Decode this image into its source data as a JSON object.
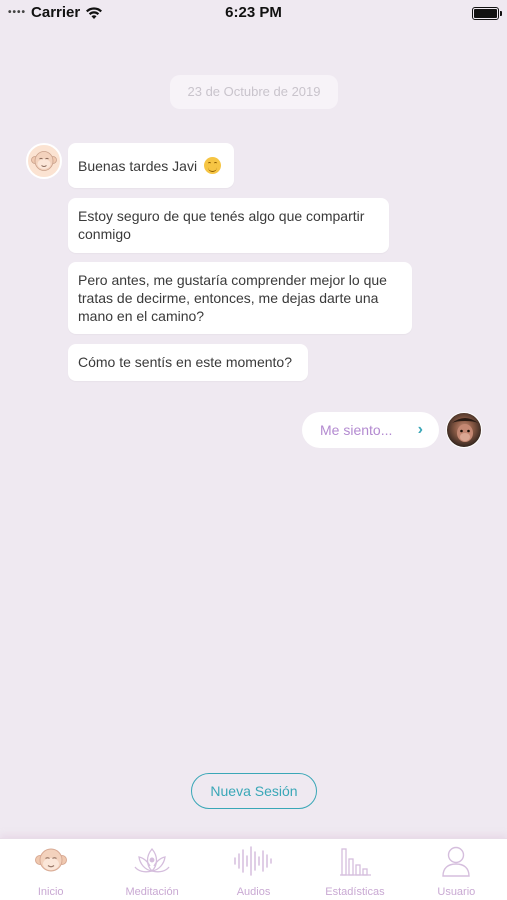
{
  "status_bar": {
    "signal": "••••",
    "carrier": "Carrier",
    "time": "6:23 PM"
  },
  "chat": {
    "date": "23 de Octubre de 2019",
    "bot_messages": [
      "Buenas tardes Javi",
      "Estoy seguro de que tenés algo que compartir conmigo",
      "Pero antes, me gustaría comprender mejor lo que tratas de decirme, entonces, me dejas darte una mano en el camino?",
      "Cómo te sentís en este momento?"
    ],
    "reply_option": "Me siento...",
    "reply_chevron": "›"
  },
  "actions": {
    "new_session": "Nueva Sesión"
  },
  "tab_bar": {
    "items": [
      {
        "label": "Inicio",
        "icon": "monkey-face-icon"
      },
      {
        "label": "Meditación",
        "icon": "lotus-icon"
      },
      {
        "label": "Audios",
        "icon": "waveform-icon"
      },
      {
        "label": "Estadísticas",
        "icon": "bar-chart-icon"
      },
      {
        "label": "Usuario",
        "icon": "user-icon"
      }
    ]
  },
  "colors": {
    "background": "#efe9f1",
    "accent_teal": "#3aa7b7",
    "accent_purple": "#b38ad0",
    "tab_inactive": "#c9a9d3"
  }
}
